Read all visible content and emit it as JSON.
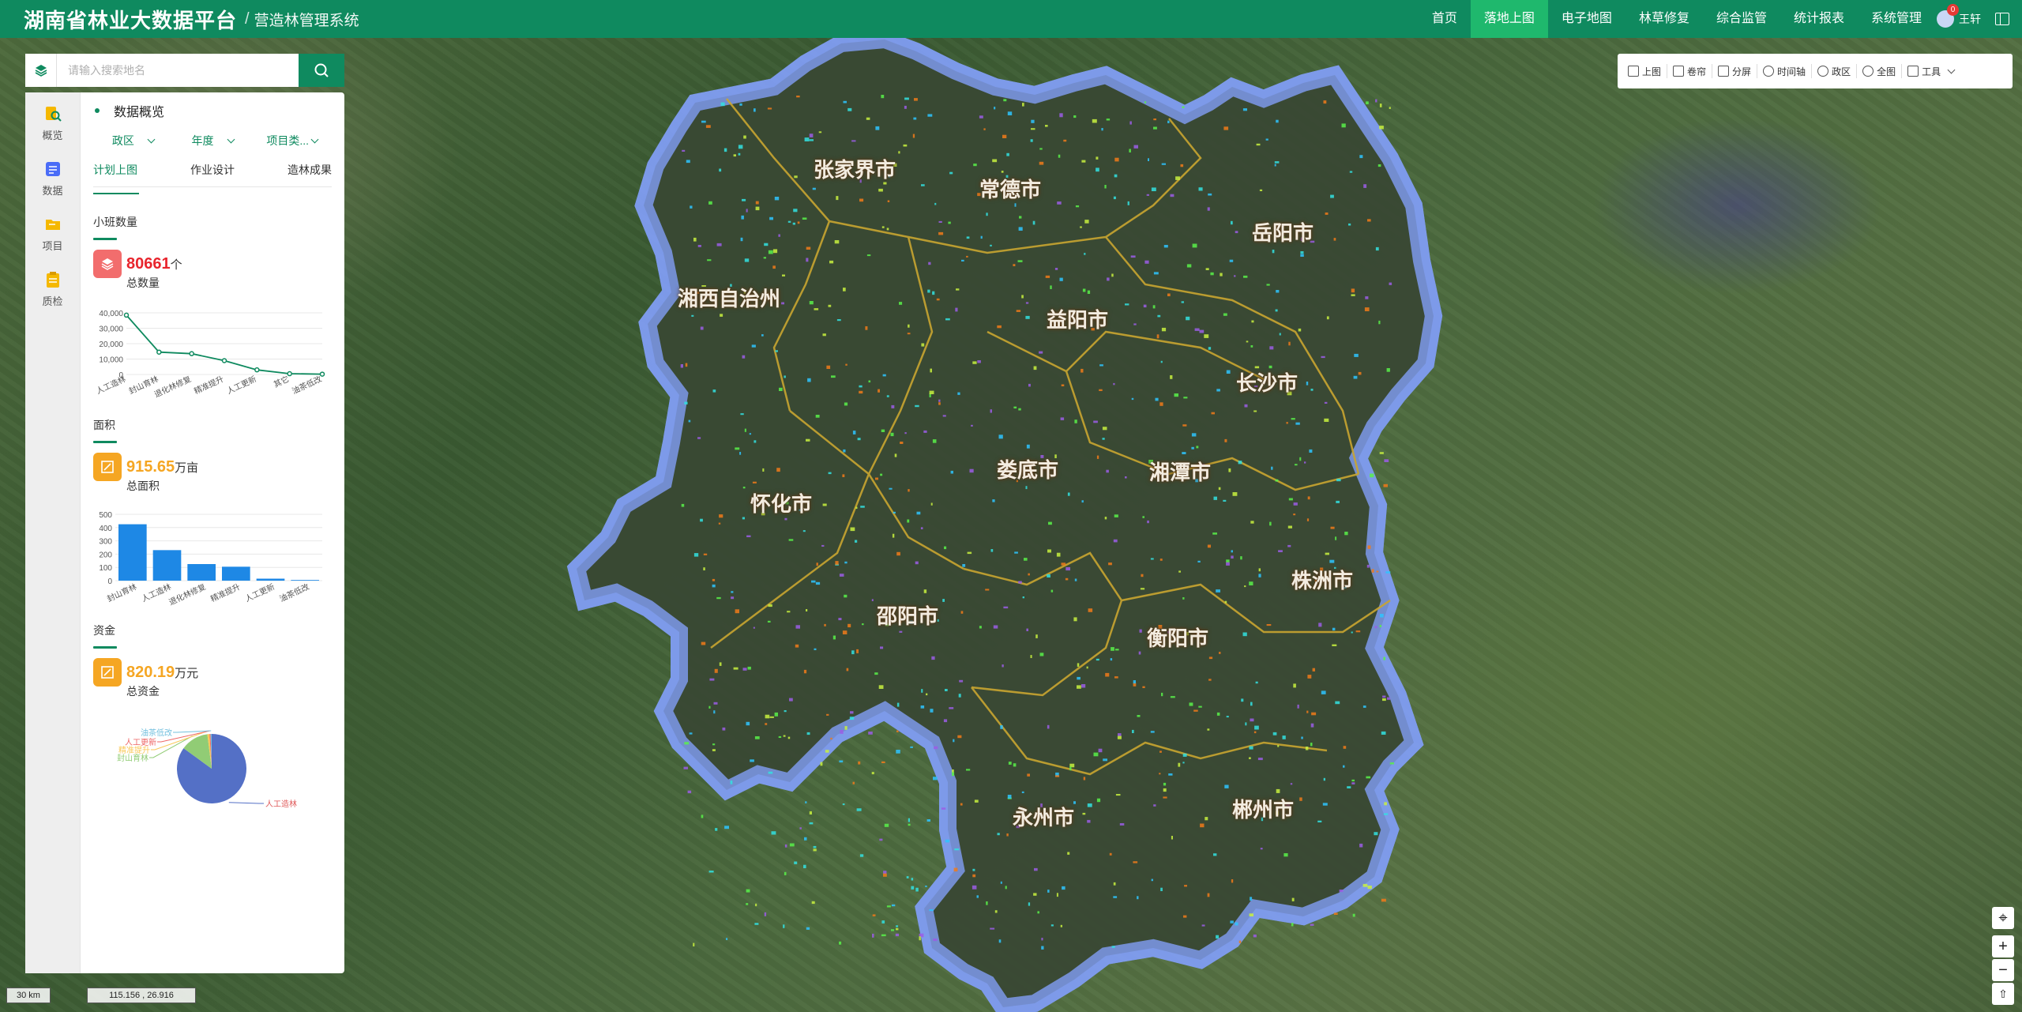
{
  "header": {
    "title": "湖南省林业大数据平台",
    "separator": "/",
    "subtitle": "营造林管理系统",
    "nav": [
      {
        "label": "首页",
        "active": false
      },
      {
        "label": "落地上图",
        "active": true
      },
      {
        "label": "电子地图",
        "active": false
      },
      {
        "label": "林草修复",
        "active": false
      },
      {
        "label": "综合监管",
        "active": false
      },
      {
        "label": "统计报表",
        "active": false
      },
      {
        "label": "系统管理",
        "active": false
      }
    ],
    "user": {
      "name": "王轩",
      "badge": "0"
    }
  },
  "search": {
    "placeholder": "请输入搜索地名",
    "value": ""
  },
  "sidebar": {
    "items": [
      {
        "label": "概览",
        "icon": "overview-icon"
      },
      {
        "label": "数据",
        "icon": "data-icon"
      },
      {
        "label": "项目",
        "icon": "folder-icon"
      },
      {
        "label": "质检",
        "icon": "clipboard-icon"
      }
    ]
  },
  "panel": {
    "title": "数据概览",
    "filters": [
      {
        "label": "政区"
      },
      {
        "label": "年度"
      },
      {
        "label": "项目类..."
      }
    ],
    "tabs": [
      {
        "label": "计划上图",
        "active": true
      },
      {
        "label": "作业设计",
        "active": false
      },
      {
        "label": "造林成果",
        "active": false
      }
    ],
    "stats": {
      "count": {
        "label": "小班数量",
        "value": "80661",
        "unit": "个",
        "sub": "总数量",
        "color": "#e8252d"
      },
      "area": {
        "label": "面积",
        "value": "915.65",
        "unit": "万亩",
        "sub": "总面积",
        "color": "#f5a623"
      },
      "fund": {
        "label": "资金",
        "value": "820.19",
        "unit": "万元",
        "sub": "总资金",
        "color": "#f5a623"
      }
    }
  },
  "chart_data": [
    {
      "type": "line",
      "categories": [
        "人工造林",
        "封山育林",
        "退化林修复",
        "精准提升",
        "人工更新",
        "其它",
        "油茶低改"
      ],
      "values": [
        38500,
        14500,
        13500,
        9000,
        3000,
        500,
        200
      ],
      "yticks": [
        "40,000",
        "30,000",
        "20,000",
        "10,000",
        "0"
      ],
      "ylim": [
        0,
        40000
      ],
      "color": "#0f8a5f"
    },
    {
      "type": "bar",
      "categories": [
        "封山育林",
        "人工造林",
        "退化林修复",
        "精准提升",
        "人工更新",
        "油茶低改"
      ],
      "values": [
        425,
        230,
        125,
        105,
        15,
        5
      ],
      "yticks": [
        "500",
        "400",
        "300",
        "200",
        "100",
        "0"
      ],
      "ylim": [
        0,
        500
      ],
      "color": "#1e88e5"
    },
    {
      "type": "pie",
      "slices": [
        {
          "label": "人工造林",
          "value": 85,
          "color": "#5470c6"
        },
        {
          "label": "封山育林",
          "value": 13,
          "color": "#91cc75"
        },
        {
          "label": "精准提升",
          "value": 1,
          "color": "#fac858"
        },
        {
          "label": "人工更新",
          "value": 0.5,
          "color": "#ee6666"
        },
        {
          "label": "油茶低改",
          "value": 0.5,
          "color": "#73c0de"
        }
      ]
    }
  ],
  "toolbar": {
    "items": [
      {
        "label": "上图",
        "icon": "edit-icon"
      },
      {
        "label": "卷帘",
        "icon": "copy-icon"
      },
      {
        "label": "分屏",
        "icon": "grid-icon"
      },
      {
        "label": "时间轴",
        "icon": "play-icon"
      },
      {
        "label": "政区",
        "icon": "location-icon"
      },
      {
        "label": "全图",
        "icon": "globe-icon"
      },
      {
        "label": "工具",
        "icon": "toolbox-icon"
      }
    ]
  },
  "map": {
    "cities": [
      "张家界市",
      "常德市",
      "岳阳市",
      "湘西自治州",
      "益阳市",
      "长沙市",
      "娄底市",
      "湘潭市",
      "怀化市",
      "邵阳市",
      "株洲市",
      "衡阳市",
      "永州市",
      "郴州市"
    ],
    "controls": {
      "locate": "⌖",
      "zoom_in": "+",
      "zoom_out": "−",
      "north": "⇧"
    },
    "scale": "30 km",
    "coords": "115.156 , 26.916"
  }
}
